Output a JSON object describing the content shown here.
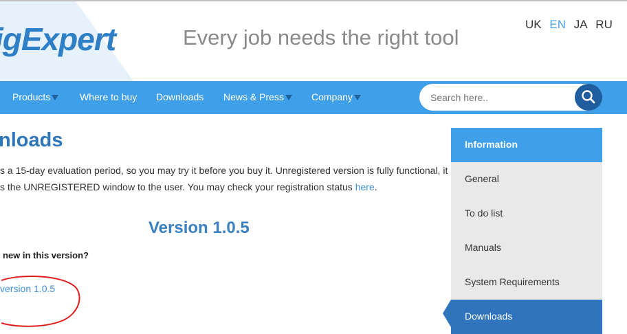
{
  "header": {
    "logo_text": "igExpert",
    "tagline": "Every job needs the right tool",
    "languages": [
      "UK",
      "EN",
      "JA",
      "RU"
    ],
    "active_language": "EN"
  },
  "nav": {
    "items": [
      {
        "label": "Products",
        "has_dropdown": true
      },
      {
        "label": "Where to buy",
        "has_dropdown": false
      },
      {
        "label": "Downloads",
        "has_dropdown": false
      },
      {
        "label": "News & Press",
        "has_dropdown": true
      },
      {
        "label": "Company",
        "has_dropdown": true
      }
    ],
    "search": {
      "placeholder": "Search here..",
      "icon": "search-icon"
    }
  },
  "main": {
    "title": "nloads",
    "intro_line1": "s a 15-day evaluation period, so you may try it before you buy it. Unregistered version is fully functional, it",
    "intro_line2": "s the UNREGISTERED window to the user. You may check your registration status ",
    "intro_link": "here",
    "intro_end": ".",
    "version_heading": "Version 1.0.5",
    "whats_new": "new in this version?",
    "version_link": "version 1.0.5"
  },
  "sidebar": {
    "header": "Information",
    "items": [
      "General",
      "To do list",
      "Manuals",
      "System Requirements",
      "Downloads"
    ],
    "active_item": "Downloads"
  },
  "colors": {
    "brand_blue": "#3f9fe8",
    "dark_blue": "#2f74bd",
    "annotation_red": "#e01e1e"
  }
}
